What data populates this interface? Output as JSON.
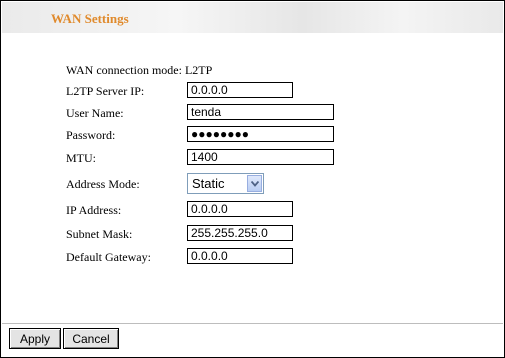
{
  "header": {
    "title": "WAN Settings"
  },
  "connection_mode": {
    "label": "WAN connection mode:",
    "value": "L2TP"
  },
  "fields": {
    "server_ip": {
      "label": "L2TP Server IP:",
      "value": "0.0.0.0"
    },
    "user_name": {
      "label": "User Name:",
      "value": "tenda"
    },
    "password": {
      "label": "Password:",
      "value": "●●●●●●●●"
    },
    "mtu": {
      "label": "MTU:",
      "value": "1400"
    },
    "address_mode": {
      "label": "Address Mode:",
      "value": "Static"
    },
    "ip_address": {
      "label": "IP Address:",
      "value": "0.0.0.0"
    },
    "subnet_mask": {
      "label": "Subnet Mask:",
      "value": "255.255.255.0"
    },
    "default_gateway": {
      "label": "Default Gateway:",
      "value": "0.0.0.0"
    }
  },
  "buttons": {
    "apply": "Apply",
    "cancel": "Cancel"
  },
  "colors": {
    "title": "#e08a2c",
    "select_border": "#7f9db9"
  }
}
